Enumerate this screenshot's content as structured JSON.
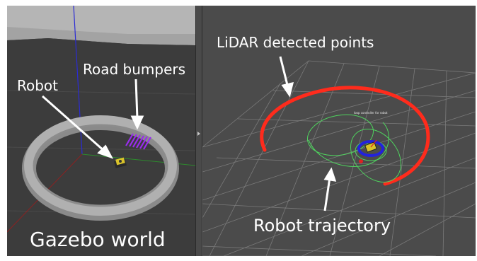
{
  "left_panel": {
    "robot_label": "Robot",
    "bumpers_label": "Road bumpers",
    "caption": "Gazebo world"
  },
  "right_panel": {
    "lidar_label": "LiDAR detected points",
    "trajectory_label": "Robot trajectory",
    "overlay_text": "loop controller for robot"
  },
  "colors": {
    "sky": "#b1b1b1",
    "ground": "#3b3b3b",
    "ring": "#a9a9a9",
    "bumpers": "#8a1fd8",
    "lidar": "#ff2b1c",
    "trajectory": "#4fd25e",
    "rviz_bg": "#4b4b4b",
    "grid": "#777777"
  }
}
